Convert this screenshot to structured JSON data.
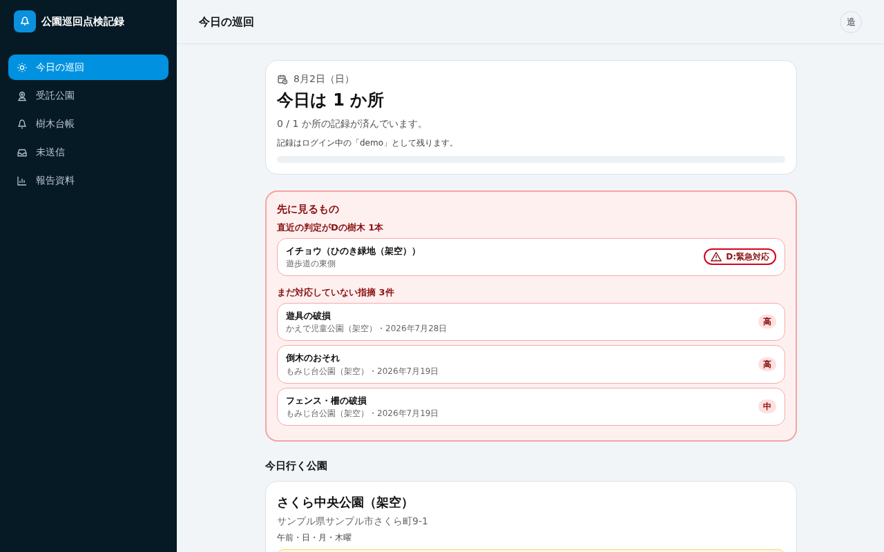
{
  "app": {
    "title": "公園巡回点検記録"
  },
  "nav": [
    {
      "label": "今日の巡回",
      "kind": "sun",
      "selected": true
    },
    {
      "label": "受託公園",
      "kind": "pin",
      "selected": false
    },
    {
      "label": "樹木台帳",
      "kind": "bell",
      "selected": false
    },
    {
      "label": "未送信",
      "kind": "inbox",
      "selected": false
    },
    {
      "label": "報告資料",
      "kind": "chart",
      "selected": false
    }
  ],
  "header": {
    "title": "今日の巡回",
    "avatar": "造"
  },
  "summary": {
    "date": "8月2日（日）",
    "headline": "今日は 1 か所",
    "progress_text": "0 / 1 か所の記録が済んでいます。",
    "note": "記録はログイン中の「demo」として残ります。",
    "level": 0
  },
  "attention": {
    "title": "先に見るもの",
    "sections": [
      {
        "heading": "直近の判定がDの樹木 1本",
        "items": [
          {
            "kind": "grade",
            "title": "イチョウ（ひのき緑地（架空））",
            "subtitle": "遊歩道の東側",
            "badge": "D:緊急対応"
          }
        ]
      },
      {
        "heading": "まだ対応していない指摘 3件",
        "items": [
          {
            "kind": "priority",
            "title": "遊具の破損",
            "subtitle": "かえで児童公園（架空）・2026年7月28日",
            "badge": "高"
          },
          {
            "kind": "priority",
            "title": "倒木のおそれ",
            "subtitle": "もみじ台公園（架空）・2026年7月19日",
            "badge": "高"
          },
          {
            "kind": "priority",
            "title": "フェンス・柵の破損",
            "subtitle": "もみじ台公園（架空）・2026年7月19日",
            "badge": "中"
          }
        ]
      }
    ]
  },
  "parks": {
    "heading": "今日行く公園",
    "items": [
      {
        "name": "さくら中央公園（架空）",
        "address": "サンプル県サンプル市さくら町9-1",
        "schedule": "午前・日・月・木曜"
      }
    ]
  }
}
